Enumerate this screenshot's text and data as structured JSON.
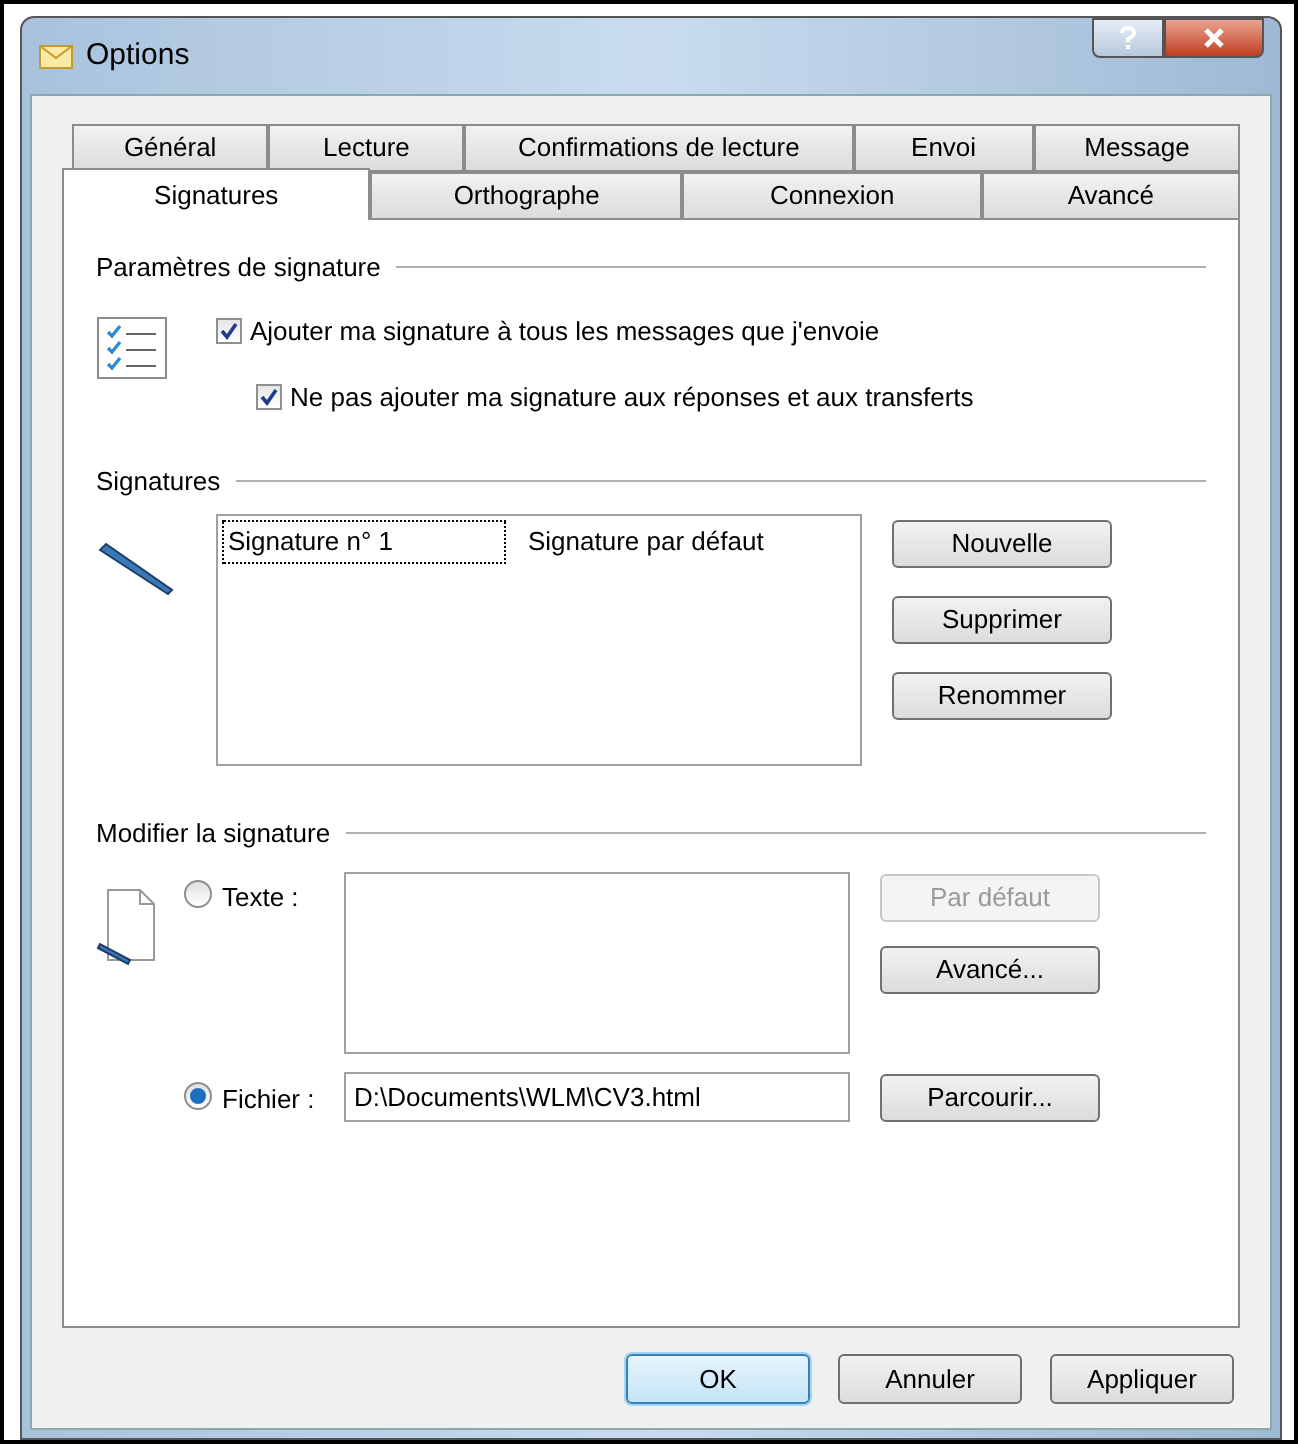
{
  "window": {
    "title": "Options"
  },
  "tab_rows": [
    {
      "tabs": [
        {
          "label": "Général",
          "selected": false
        },
        {
          "label": "Lecture",
          "selected": false
        },
        {
          "label": "Confirmations de lecture",
          "selected": false
        },
        {
          "label": "Envoi",
          "selected": false
        },
        {
          "label": "Message",
          "selected": false
        }
      ]
    },
    {
      "tabs": [
        {
          "label": "Signatures",
          "selected": true
        },
        {
          "label": "Orthographe",
          "selected": false
        },
        {
          "label": "Connexion",
          "selected": false
        },
        {
          "label": "Avancé",
          "selected": false
        }
      ]
    }
  ],
  "signature_settings": {
    "title": "Paramètres de signature",
    "options": [
      {
        "label": "Ajouter ma signature à tous les messages que j'envoie",
        "checked": true
      },
      {
        "label": "Ne pas ajouter ma signature aux réponses et aux transferts",
        "checked": true
      }
    ]
  },
  "signatures": {
    "title": "Signatures",
    "list": [
      {
        "name": "Signature n° 1",
        "note": "Signature par défaut",
        "selected": true
      }
    ],
    "buttons": [
      {
        "label": "Nouvelle",
        "disabled": false
      },
      {
        "label": "Supprimer",
        "disabled": false
      },
      {
        "label": "Renommer",
        "disabled": false
      }
    ]
  },
  "edit_signature": {
    "title": "Modifier la signature",
    "sources": [
      {
        "kind": "text",
        "label": "Texte :",
        "selected": false,
        "buttons": [
          {
            "label": "Par défaut",
            "disabled": true
          },
          {
            "label": "Avancé...",
            "disabled": false
          }
        ]
      },
      {
        "kind": "file",
        "label": "Fichier :",
        "selected": true,
        "value": "D:\\Documents\\WLM\\CV3.html",
        "buttons": [
          {
            "label": "Parcourir...",
            "disabled": false
          }
        ]
      }
    ]
  },
  "dialog_buttons": [
    {
      "label": "OK",
      "default": true
    },
    {
      "label": "Annuler",
      "default": false
    },
    {
      "label": "Appliquer",
      "default": false
    }
  ]
}
